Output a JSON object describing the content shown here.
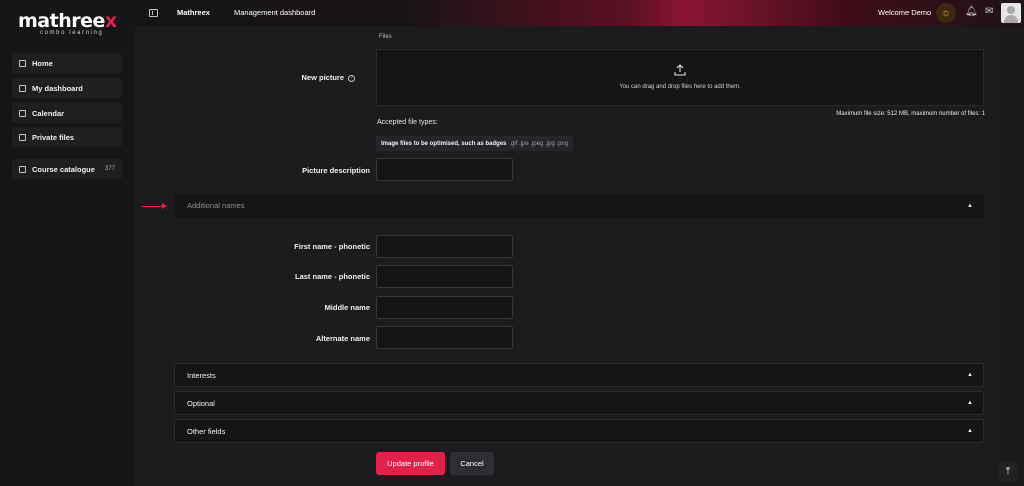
{
  "brand": {
    "logo_main": "mathree",
    "logo_x": "x",
    "logo_sub": "combo learning",
    "accent_color": "#e0224a"
  },
  "sidebar": {
    "items": [
      {
        "label": "Home",
        "icon": "home-icon"
      },
      {
        "label": "My dashboard",
        "icon": "dashboard-icon"
      },
      {
        "label": "Calendar",
        "icon": "calendar-icon"
      },
      {
        "label": "Private files",
        "icon": "file-icon"
      }
    ],
    "catalogue": {
      "label": "Course catalogue",
      "count": "377",
      "icon": "catalogue-icon"
    }
  },
  "topbar": {
    "site_name": "Mathreex",
    "management": "Management dashboard",
    "welcome": "Welcome Demo",
    "icons": [
      "drawer-toggle-icon",
      "sun-icon",
      "bell-icon",
      "chat-icon",
      "avatar"
    ]
  },
  "form": {
    "files_label": "Files",
    "new_picture_label": "New picture",
    "dropzone_text": "You can drag and drop files here to add them.",
    "max_size": "Maximum file size: 512 MB, maximum number of files: 1",
    "accepted_label": "Accepted file types:",
    "types_name": "Image files to be optimised, such as badges",
    "types_ext": ".gif .jpe .jpeg .jpg .png",
    "picture_description_label": "Picture description",
    "additional_names": "Additional names",
    "first_name_phonetic": "First name - phonetic",
    "last_name_phonetic": "Last name - phonetic",
    "middle_name": "Middle name",
    "alternate_name": "Alternate name",
    "sections": [
      "Interests",
      "Optional",
      "Other fields"
    ],
    "update_button": "Update profile",
    "cancel_button": "Cancel"
  }
}
